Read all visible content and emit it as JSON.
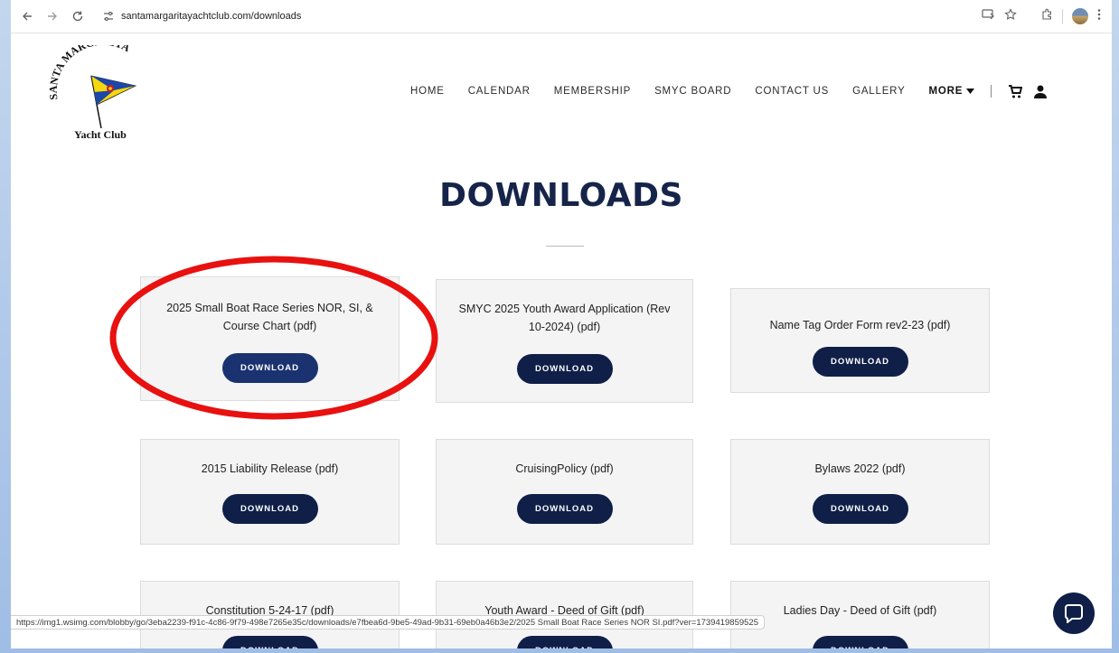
{
  "browser": {
    "url": "santamargaritayachtclub.com/downloads",
    "status_url": "https://img1.wsimg.com/blobby/go/3eba2239-f91c-4c86-9f79-498e7265e35c/downloads/e7fbea6d-9be5-49ad-9b31-69eb0a46b3e2/2025 Small Boat Race Series NOR SI.pdf?ver=1739419859525"
  },
  "site": {
    "logo_top_text": "SANTA MARGARITA",
    "logo_bottom_text": "Yacht Club"
  },
  "nav": {
    "items": [
      "HOME",
      "CALENDAR",
      "MEMBERSHIP",
      "SMYC BOARD",
      "CONTACT US",
      "GALLERY"
    ],
    "more_label": "MORE"
  },
  "page": {
    "heading": "DOWNLOADS"
  },
  "downloads": [
    {
      "title": "2025 Small Boat Race Series NOR, SI, & Course Chart (pdf)",
      "button": "DOWNLOAD"
    },
    {
      "title": "SMYC 2025 Youth Award Application (Rev 10-2024) (pdf)",
      "button": "DOWNLOAD"
    },
    {
      "title": "Name Tag Order Form rev2-23 (pdf)",
      "button": "DOWNLOAD"
    },
    {
      "title": "2015 Liability Release (pdf)",
      "button": "DOWNLOAD"
    },
    {
      "title": "CruisingPolicy (pdf)",
      "button": "DOWNLOAD"
    },
    {
      "title": "Bylaws 2022 (pdf)",
      "button": "DOWNLOAD"
    },
    {
      "title": "Constitution 5-24-17 (pdf)",
      "button": "DOWNLOAD"
    },
    {
      "title": "Youth Award - Deed of Gift (pdf)",
      "button": "DOWNLOAD"
    },
    {
      "title": "Ladies Day - Deed of Gift (pdf)",
      "button": "DOWNLOAD"
    }
  ],
  "colors": {
    "navy": "#0f1f48",
    "heading": "#16244a",
    "highlight_ring": "#e8110f"
  }
}
